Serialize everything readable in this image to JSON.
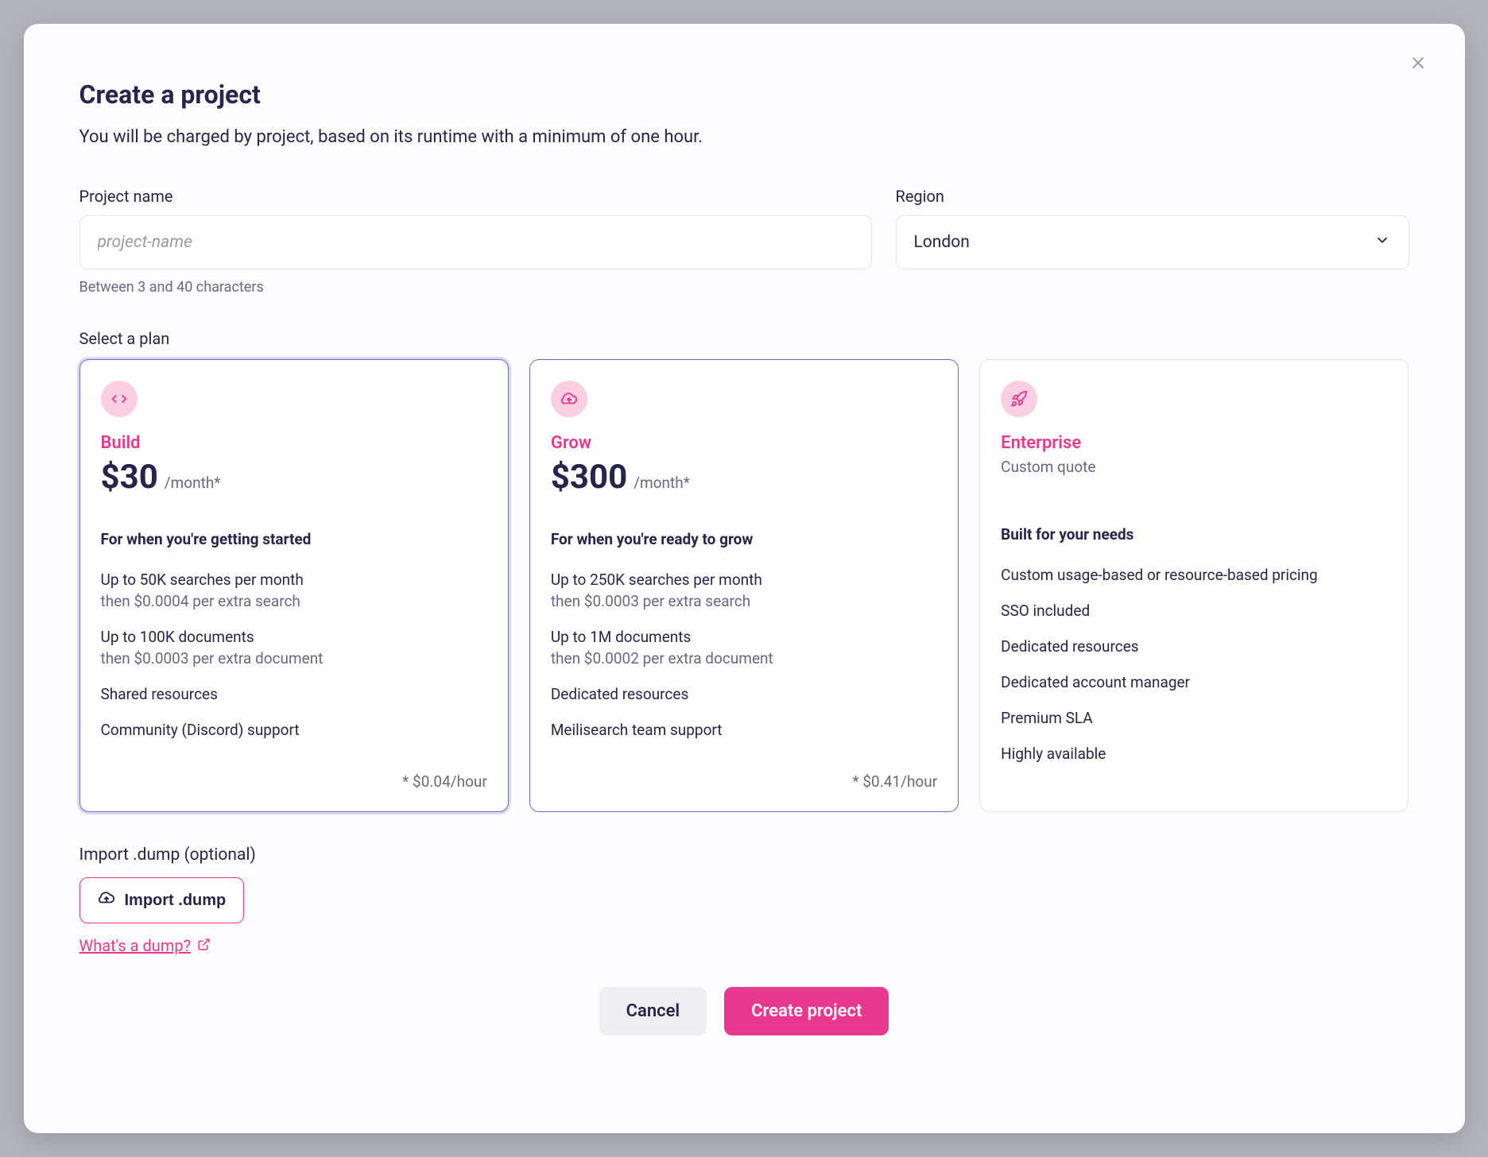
{
  "title": "Create a project",
  "subtitle": "You will be charged by project, based on its runtime with a minimum of one hour.",
  "projectName": {
    "label": "Project name",
    "placeholder": "project-name",
    "helper": "Between 3 and 40 characters"
  },
  "region": {
    "label": "Region",
    "value": "London"
  },
  "planSectionLabel": "Select a plan",
  "plans": {
    "build": {
      "name": "Build",
      "price": "$30",
      "period": "/month*",
      "tagline": "For when you're getting started",
      "feat1": "Up to 50K searches per month",
      "feat1sub": "then $0.0004 per extra search",
      "feat2": "Up to 100K documents",
      "feat2sub": "then $0.0003 per extra document",
      "feat3": "Shared resources",
      "feat4": "Community (Discord) support",
      "footer": "* $0.04/hour"
    },
    "grow": {
      "name": "Grow",
      "price": "$300",
      "period": "/month*",
      "tagline": "For when you're ready to grow",
      "feat1": "Up to 250K searches per month",
      "feat1sub": "then $0.0003 per extra search",
      "feat2": "Up to 1M documents",
      "feat2sub": "then $0.0002 per extra document",
      "feat3": "Dedicated resources",
      "feat4": "Meilisearch team support",
      "footer": "* $0.41/hour"
    },
    "enterprise": {
      "name": "Enterprise",
      "custom": "Custom quote",
      "tagline": "Built for your needs",
      "feat1": "Custom usage-based or resource-based pricing",
      "feat2": "SSO included",
      "feat3": "Dedicated resources",
      "feat4": "Dedicated account manager",
      "feat5": "Premium SLA",
      "feat6": "Highly available"
    }
  },
  "import": {
    "label": "Import .dump (optional)",
    "button": "Import .dump",
    "link": "What's a dump?"
  },
  "actions": {
    "cancel": "Cancel",
    "create": "Create project"
  }
}
